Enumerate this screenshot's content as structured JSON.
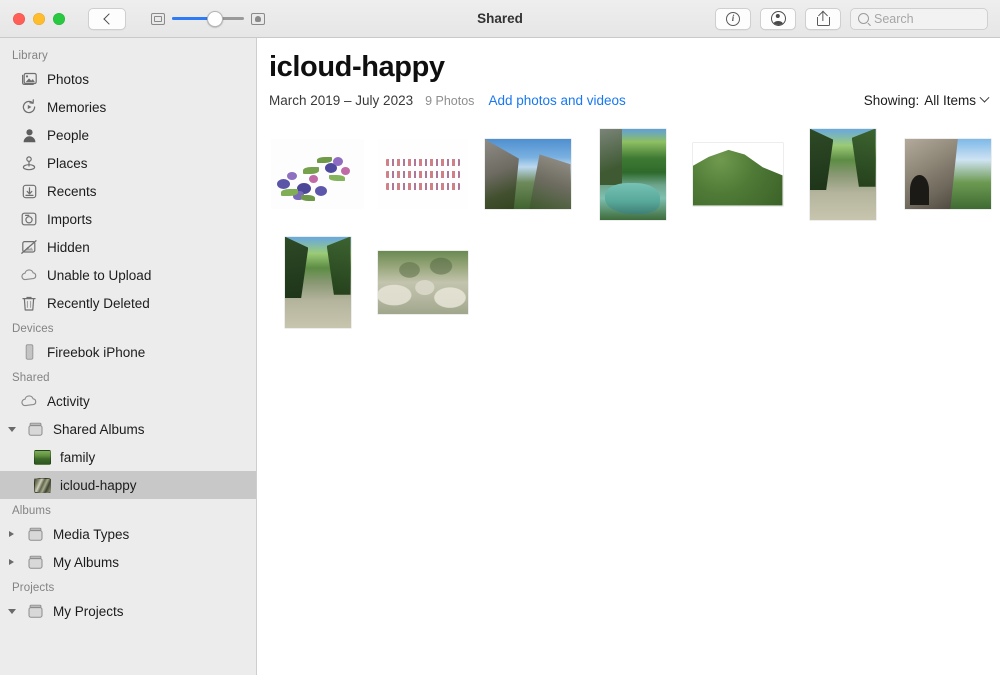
{
  "window": {
    "title": "Shared",
    "traffic_lights": [
      "close",
      "minimize",
      "maximize"
    ]
  },
  "toolbar": {
    "back_label": "",
    "zoom_slider_value": 52,
    "info_label": "i",
    "buttons": [
      "info",
      "people",
      "share"
    ],
    "search": {
      "placeholder": "Search",
      "value": ""
    }
  },
  "sidebar": {
    "sections": [
      {
        "title": "Library",
        "items": [
          {
            "label": "Photos",
            "icon": "photos-icon"
          },
          {
            "label": "Memories",
            "icon": "memories-icon"
          },
          {
            "label": "People",
            "icon": "people-icon"
          },
          {
            "label": "Places",
            "icon": "places-icon"
          },
          {
            "label": "Recents",
            "icon": "recents-icon"
          },
          {
            "label": "Imports",
            "icon": "imports-icon"
          },
          {
            "label": "Hidden",
            "icon": "hidden-icon"
          },
          {
            "label": "Unable to Upload",
            "icon": "cloud-icon"
          },
          {
            "label": "Recently Deleted",
            "icon": "trash-icon"
          }
        ]
      },
      {
        "title": "Devices",
        "items": [
          {
            "label": "Fireebok iPhone",
            "icon": "iphone-icon"
          }
        ]
      },
      {
        "title": "Shared",
        "items": [
          {
            "label": "Activity",
            "icon": "cloud-icon"
          },
          {
            "label": "Shared Albums",
            "icon": "album-icon",
            "disclosure": "open"
          },
          {
            "label": "family",
            "icon": "album-thumb-family",
            "indent": 1
          },
          {
            "label": "icloud-happy",
            "icon": "album-thumb-happy",
            "indent": 1,
            "selected": true
          }
        ]
      },
      {
        "title": "Albums",
        "items": [
          {
            "label": "Media Types",
            "icon": "album-icon",
            "disclosure": "closed"
          },
          {
            "label": "My Albums",
            "icon": "album-icon",
            "disclosure": "closed"
          }
        ]
      },
      {
        "title": "Projects",
        "items": [
          {
            "label": "My Projects",
            "icon": "album-icon",
            "disclosure": "open"
          }
        ]
      }
    ]
  },
  "main": {
    "album_title": "icloud-happy",
    "date_range": "March 2019 – July 2023",
    "photo_count": "9 Photos",
    "add_link": "Add photos and videos",
    "showing_label": "Showing:",
    "showing_value": "All Items",
    "photos": [
      {
        "name": "floral-watercolor",
        "orientation": "landscape"
      },
      {
        "name": "decorative-text",
        "orientation": "landscape"
      },
      {
        "name": "canyon-blue-sky",
        "orientation": "landscape"
      },
      {
        "name": "river-gorge",
        "orientation": "portrait"
      },
      {
        "name": "green-hill",
        "orientation": "landscape"
      },
      {
        "name": "forest-gorge",
        "orientation": "portrait"
      },
      {
        "name": "rock-cliff",
        "orientation": "landscape"
      },
      {
        "name": "ravine-stream",
        "orientation": "portrait"
      },
      {
        "name": "rocky-slope",
        "orientation": "landscape"
      }
    ]
  },
  "colors": {
    "accent_blue": "#1878f0",
    "sidebar_bg": "#ececec",
    "selection_gray": "#c8c8c8",
    "slider_blue": "#2f7bf6"
  }
}
